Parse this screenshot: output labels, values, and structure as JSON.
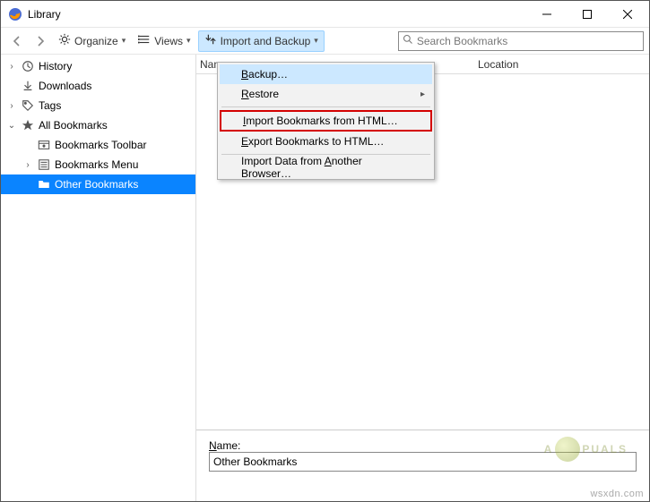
{
  "window": {
    "title": "Library"
  },
  "toolbar": {
    "organize": "Organize",
    "views": "Views",
    "import_backup": "Import and Backup"
  },
  "search": {
    "placeholder": "Search Bookmarks"
  },
  "sidebar": {
    "history": "History",
    "downloads": "Downloads",
    "tags": "Tags",
    "all_bookmarks": "All Bookmarks",
    "bookmarks_toolbar": "Bookmarks Toolbar",
    "bookmarks_menu": "Bookmarks Menu",
    "other_bookmarks": "Other Bookmarks"
  },
  "columns": {
    "name": "Name",
    "location": "Location"
  },
  "menu": {
    "backup": "Backup…",
    "restore": "Restore",
    "import_html": "Import Bookmarks from HTML…",
    "export_html": "Export Bookmarks to HTML…",
    "import_other": "Import Data from Another Browser…"
  },
  "details": {
    "name_label_prefix": "N",
    "name_label_rest": "ame:",
    "name_value": "Other Bookmarks"
  },
  "watermark": {
    "left": "A",
    "right": "PUALS"
  },
  "credit": "wsxdn.com"
}
